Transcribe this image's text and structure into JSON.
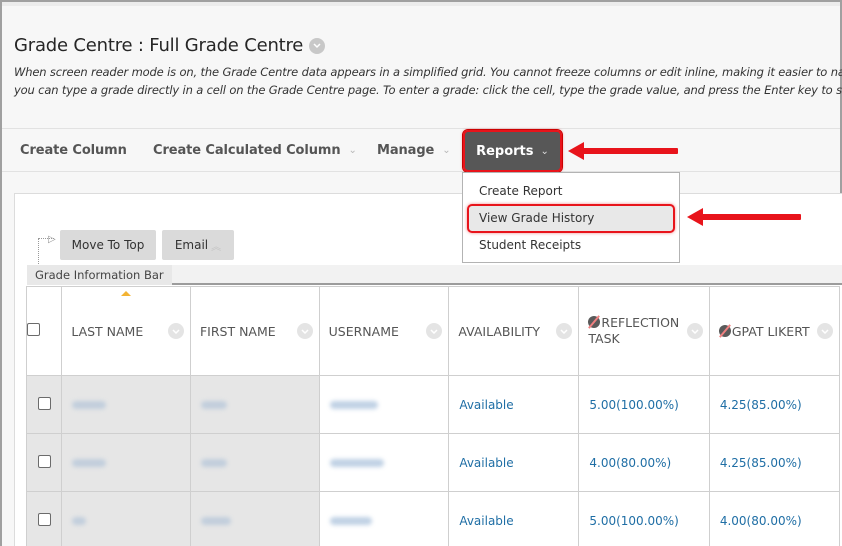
{
  "page": {
    "title": "Grade Centre : Full Grade Centre",
    "instructions_line1": "When screen reader mode is on, the Grade Centre data appears in a simplified grid. You cannot freeze columns or edit inline, making it easier to na",
    "instructions_line2": "you can type a grade directly in a cell on the Grade Centre page. To enter a grade: click the cell, type the grade value, and press the Enter key to subr"
  },
  "action_bar": {
    "items": [
      {
        "label": "Create Column",
        "has_menu": false
      },
      {
        "label": "Create Calculated Column",
        "has_menu": true
      },
      {
        "label": "Manage",
        "has_menu": true
      },
      {
        "label": "Reports",
        "has_menu": true,
        "active": true
      }
    ]
  },
  "reports_menu": {
    "items": [
      "Create Report",
      "View Grade History",
      "Student Receipts"
    ],
    "highlighted": "View Grade History"
  },
  "toolbar": {
    "move_to_top": "Move To Top",
    "email": "Email",
    "info_bar": "Grade Information Bar"
  },
  "grid": {
    "columns": [
      {
        "label": "LAST NAME",
        "sorted": true,
        "hidden_from_students": false
      },
      {
        "label": "FIRST NAME",
        "hidden_from_students": false
      },
      {
        "label": "USERNAME",
        "hidden_from_students": false
      },
      {
        "label": "AVAILABILITY",
        "hidden_from_students": false
      },
      {
        "label": "REFLECTION TASK",
        "hidden_from_students": true
      },
      {
        "label": "GPAT LIKERT",
        "hidden_from_students": true
      }
    ],
    "rows": [
      {
        "last_name": "[blurred]",
        "first_name": "[blurred]",
        "username": "[blurred]",
        "availability": "Available",
        "reflection_task": "5.00(100.00%)",
        "gpat_likert": "4.25(85.00%)"
      },
      {
        "last_name": "[blurred]",
        "first_name": "[blurred]",
        "username": "[blurred]",
        "availability": "Available",
        "reflection_task": "4.00(80.00%)",
        "gpat_likert": "4.25(85.00%)"
      },
      {
        "last_name": "[blurred]",
        "first_name": "[blurred]",
        "username": "[blurred]",
        "availability": "Available",
        "reflection_task": "5.00(100.00%)",
        "gpat_likert": "4.00(80.00%)"
      }
    ]
  },
  "colors": {
    "annotation_red": "#e8141b",
    "link_blue": "#1f6ea5",
    "reports_bg": "#575757",
    "sort_caret": "#f3b333"
  }
}
